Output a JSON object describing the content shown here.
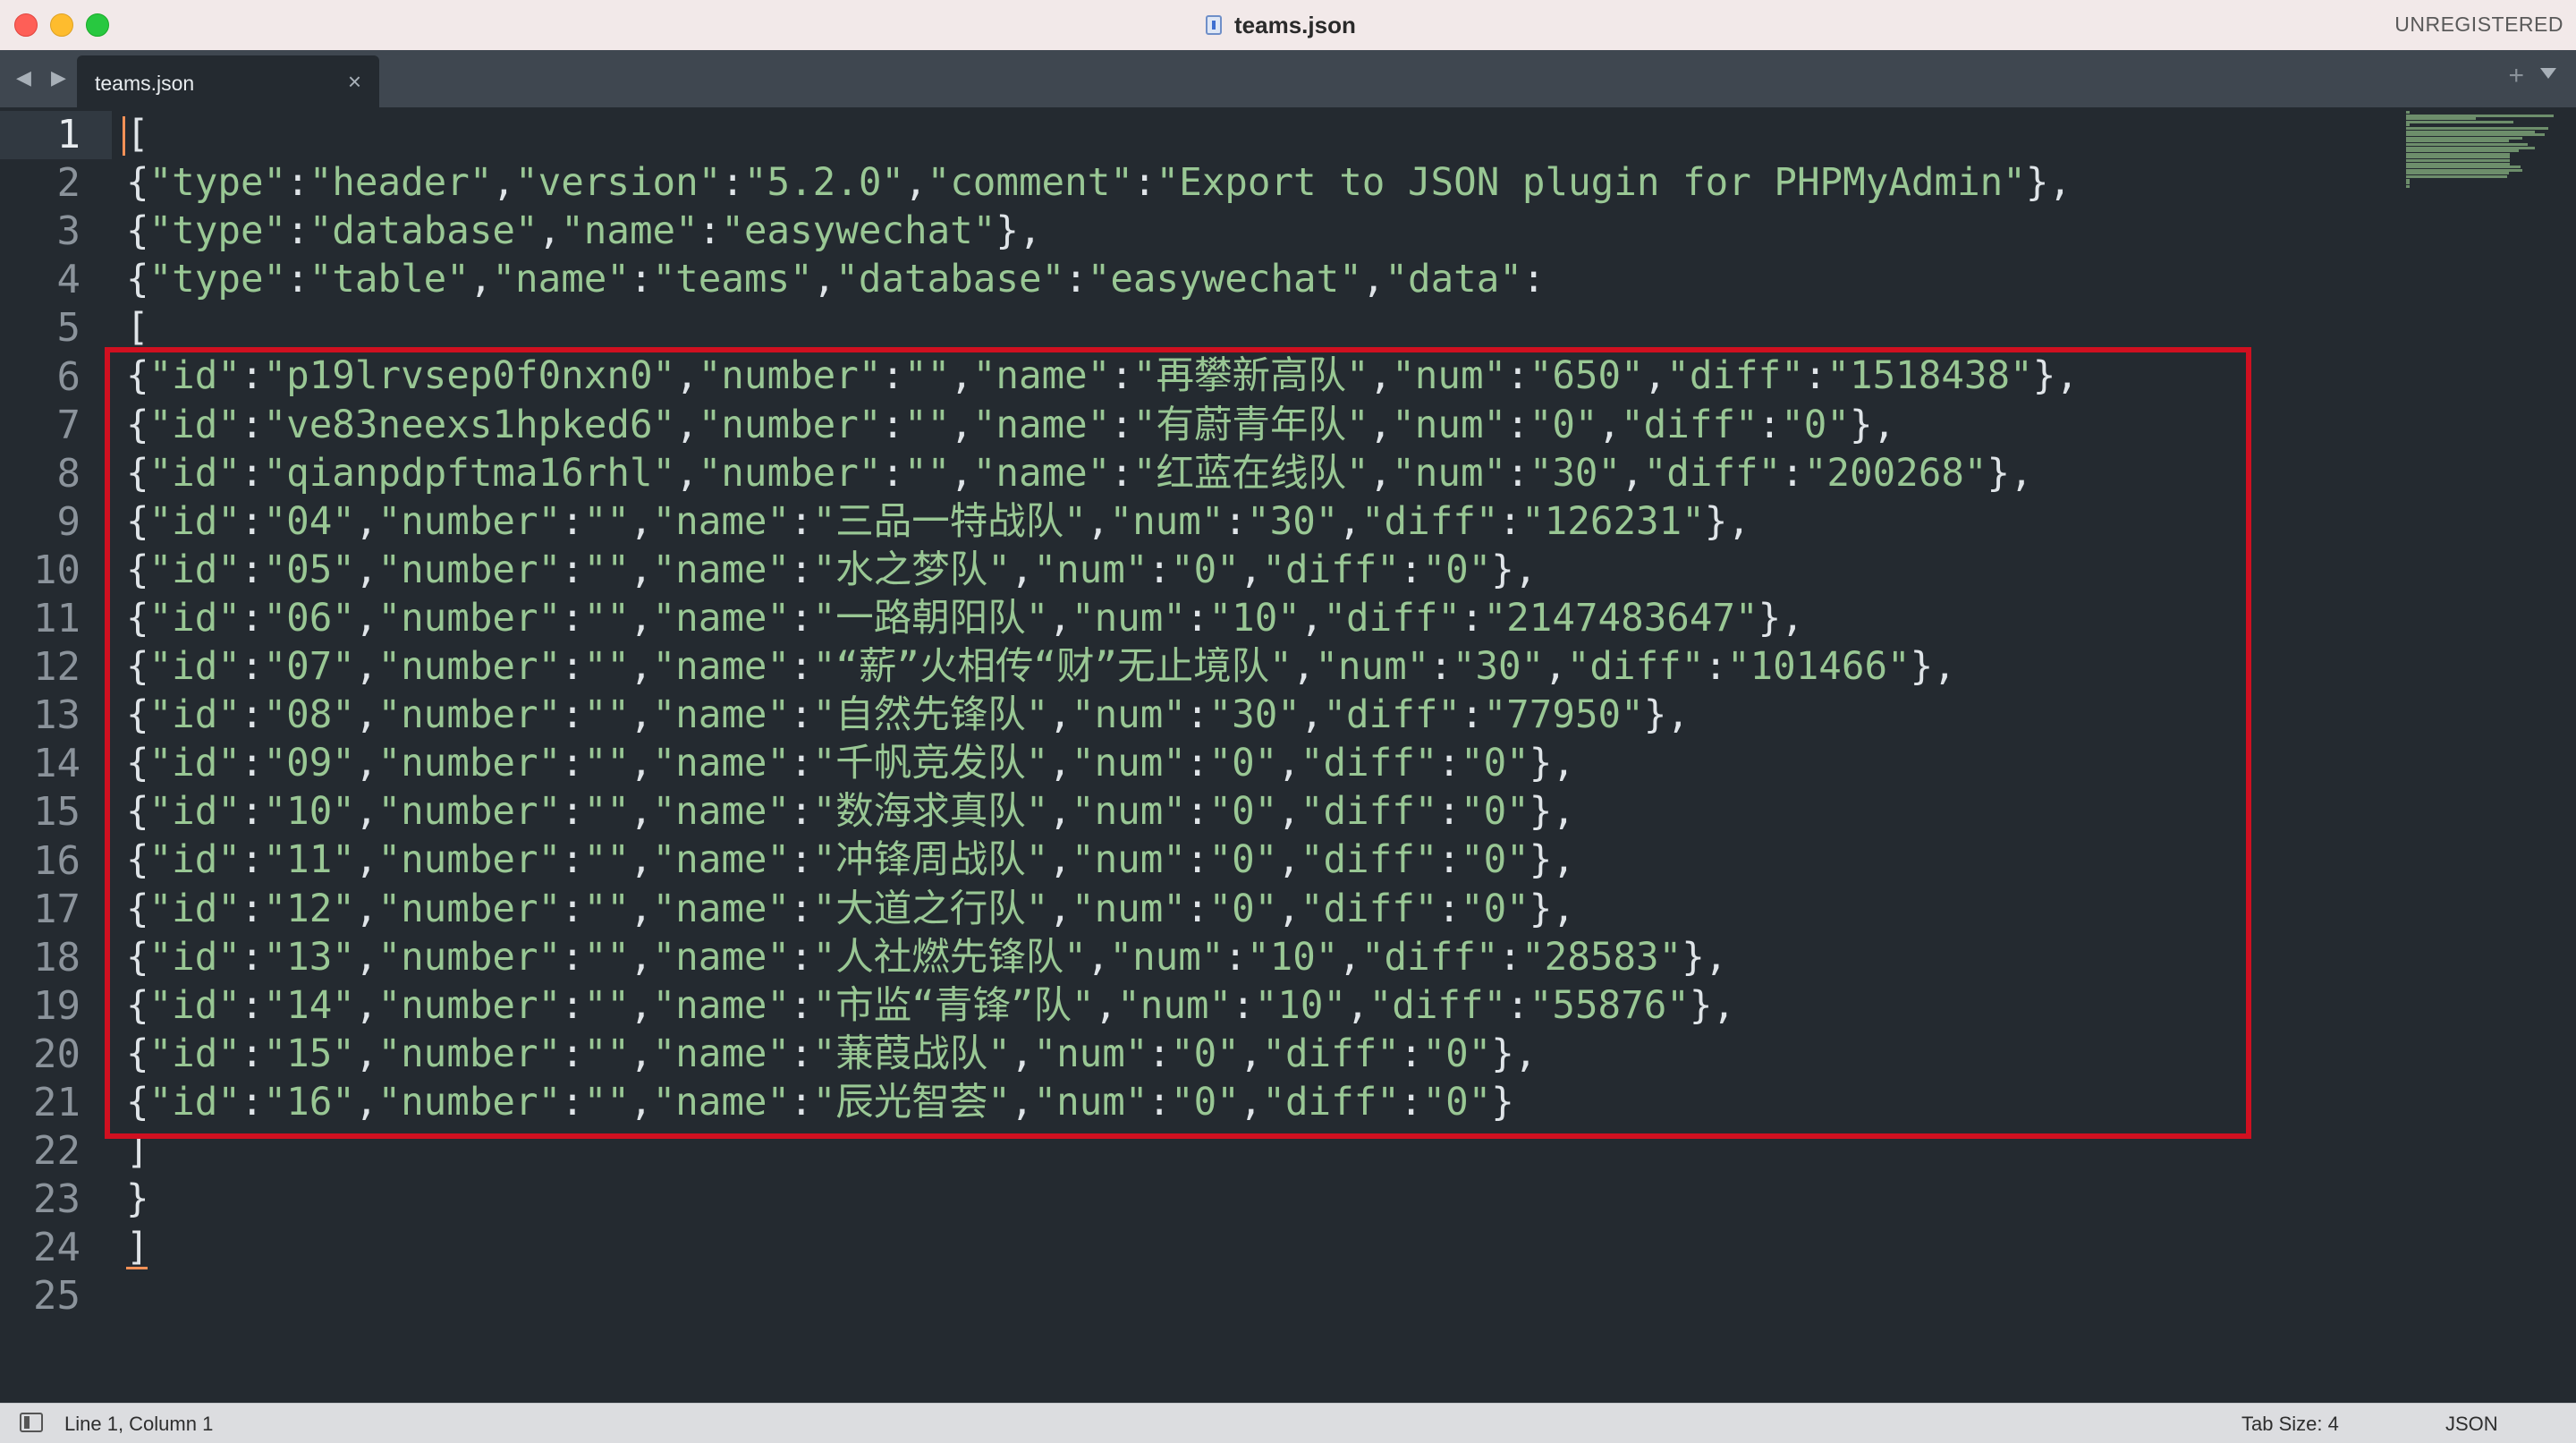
{
  "window": {
    "title": "teams.json",
    "registration": "UNREGISTERED",
    "icons": {
      "close": "close-traffic-light",
      "minimize": "minimize-traffic-light",
      "maximize": "zoom-traffic-light",
      "file": "json-file-icon"
    }
  },
  "tabs": [
    {
      "label": "teams.json",
      "close_glyph": "×"
    }
  ],
  "tabbar": {
    "nav_glyph": "◀ ▶",
    "new_tab_glyph": "+"
  },
  "editor": {
    "line_numbers": [
      "1",
      "2",
      "3",
      "4",
      "5",
      "6",
      "7",
      "8",
      "9",
      "10",
      "11",
      "12",
      "13",
      "14",
      "15",
      "16",
      "17",
      "18",
      "19",
      "20",
      "21",
      "22",
      "23",
      "24",
      "25"
    ],
    "current_line": 1,
    "lines": [
      "[",
      "{\"type\":\"header\",\"version\":\"5.2.0\",\"comment\":\"Export to JSON plugin for PHPMyAdmin\"},",
      "{\"type\":\"database\",\"name\":\"easywechat\"},",
      "{\"type\":\"table\",\"name\":\"teams\",\"database\":\"easywechat\",\"data\":",
      "[",
      "{\"id\":\"p19lrvsep0f0nxn0\",\"number\":\"\",\"name\":\"再攀新高队\",\"num\":\"650\",\"diff\":\"1518438\"},",
      "{\"id\":\"ve83neexs1hpked6\",\"number\":\"\",\"name\":\"有蔚青年队\",\"num\":\"0\",\"diff\":\"0\"},",
      "{\"id\":\"qianpdpftma16rhl\",\"number\":\"\",\"name\":\"红蓝在线队\",\"num\":\"30\",\"diff\":\"200268\"},",
      "{\"id\":\"04\",\"number\":\"\",\"name\":\"三品一特战队\",\"num\":\"30\",\"diff\":\"126231\"},",
      "{\"id\":\"05\",\"number\":\"\",\"name\":\"水之梦队\",\"num\":\"0\",\"diff\":\"0\"},",
      "{\"id\":\"06\",\"number\":\"\",\"name\":\"一路朝阳队\",\"num\":\"10\",\"diff\":\"2147483647\"},",
      "{\"id\":\"07\",\"number\":\"\",\"name\":\"“薪”火相传“财”无止境队\",\"num\":\"30\",\"diff\":\"101466\"},",
      "{\"id\":\"08\",\"number\":\"\",\"name\":\"自然先锋队\",\"num\":\"30\",\"diff\":\"77950\"},",
      "{\"id\":\"09\",\"number\":\"\",\"name\":\"千帆竞发队\",\"num\":\"0\",\"diff\":\"0\"},",
      "{\"id\":\"10\",\"number\":\"\",\"name\":\"数海求真队\",\"num\":\"0\",\"diff\":\"0\"},",
      "{\"id\":\"11\",\"number\":\"\",\"name\":\"冲锋周战队\",\"num\":\"0\",\"diff\":\"0\"},",
      "{\"id\":\"12\",\"number\":\"\",\"name\":\"大道之行队\",\"num\":\"0\",\"diff\":\"0\"},",
      "{\"id\":\"13\",\"number\":\"\",\"name\":\"人社燃先锋队\",\"num\":\"10\",\"diff\":\"28583\"},",
      "{\"id\":\"14\",\"number\":\"\",\"name\":\"市监“青锋”队\",\"num\":\"10\",\"diff\":\"55876\"},",
      "{\"id\":\"15\",\"number\":\"\",\"name\":\"蒹葭战队\",\"num\":\"0\",\"diff\":\"0\"},",
      "{\"id\":\"16\",\"number\":\"\",\"name\":\"辰光智荟\",\"num\":\"0\",\"diff\":\"0\"}",
      "]",
      "}",
      "]",
      ""
    ],
    "colors": {
      "background": "#242a30",
      "string": "#99c794",
      "punctuation": "#dfe4e8",
      "caret": "#f99157",
      "highlight_box": "#d01020"
    }
  },
  "statusbar": {
    "position": "Line 1, Column 1",
    "tab_size": "Tab Size: 4",
    "syntax": "JSON",
    "icon": "panel-toggle-icon"
  }
}
